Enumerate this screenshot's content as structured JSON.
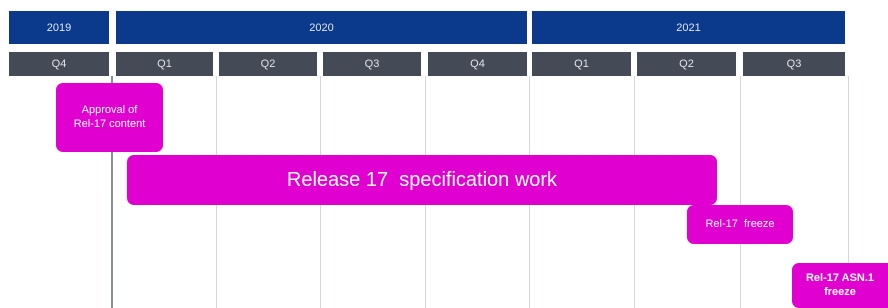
{
  "years": [
    "2019",
    "2020",
    "2021"
  ],
  "quarters": [
    "Q4",
    "Q1",
    "Q2",
    "Q3",
    "Q4",
    "Q1",
    "Q2",
    "Q3"
  ],
  "milestones": {
    "approval": "Approval of\nRel-17 content",
    "spec_work": "Release 17  specification work",
    "freeze": "Rel-17  freeze",
    "asn1_freeze": "Rel-17 ASN.1\nfreeze"
  },
  "colors": {
    "year_header": "#0b3a8c",
    "quarter_header": "#454b56",
    "milestone": "#e000d0"
  }
}
